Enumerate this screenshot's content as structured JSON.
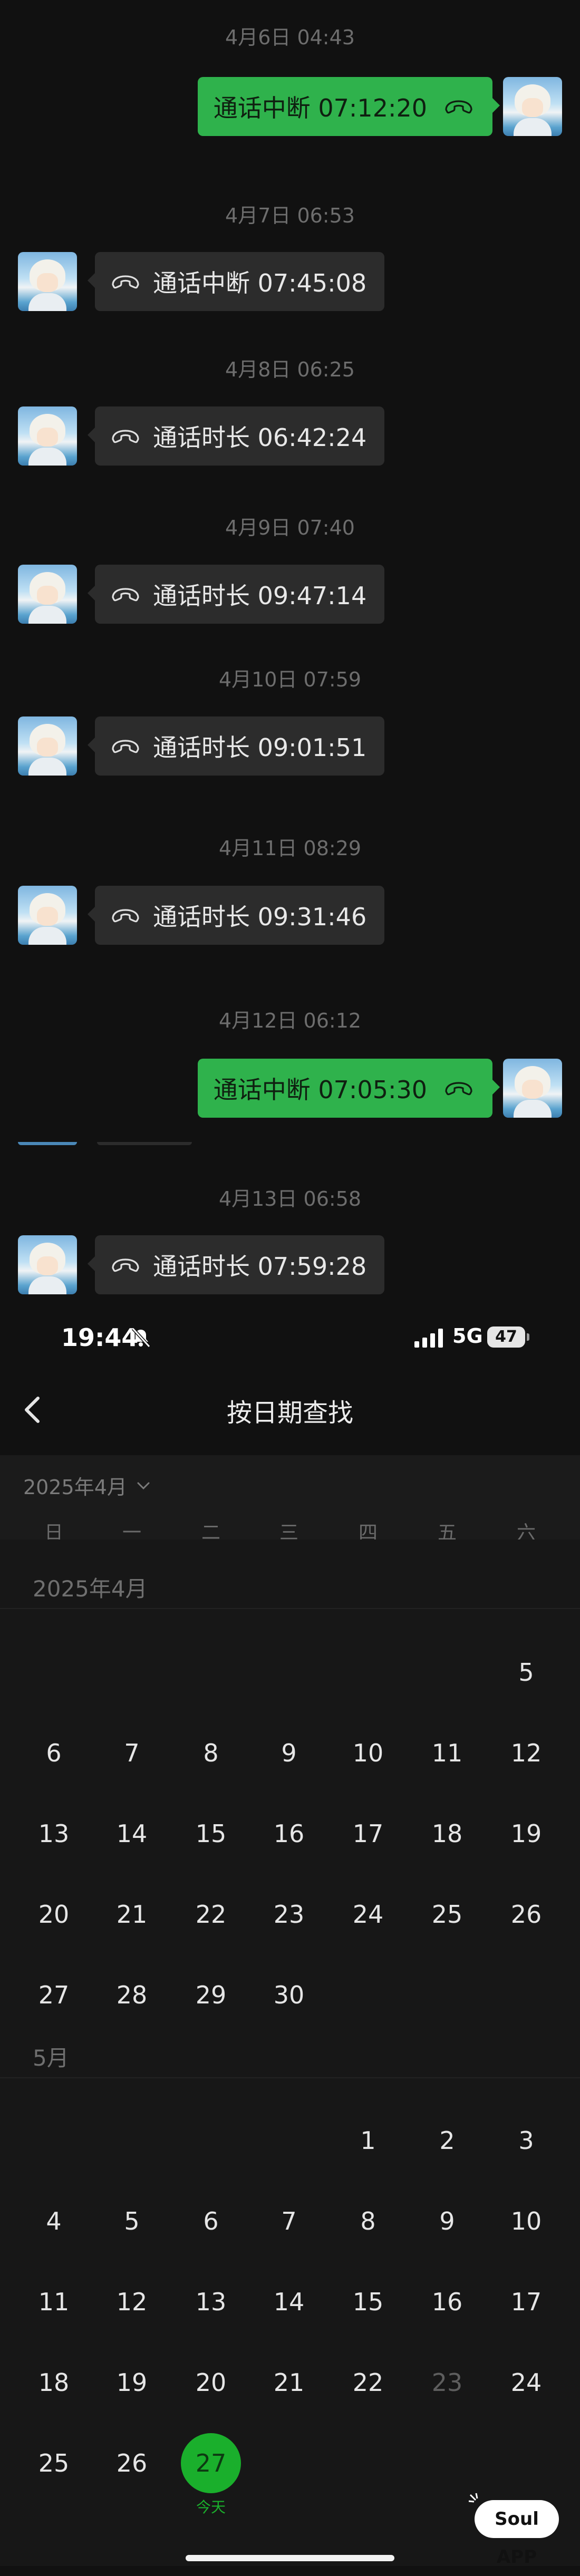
{
  "chat": {
    "messages": [
      {
        "timestamp": "4月6日 04:43",
        "direction": "out",
        "text": "通话中断 07:12:20"
      },
      {
        "timestamp": "4月7日 06:53",
        "direction": "in",
        "text": "通话中断 07:45:08"
      },
      {
        "timestamp": "4月8日 06:25",
        "direction": "in",
        "text": "通话时长 06:42:24"
      },
      {
        "timestamp": "4月9日 07:40",
        "direction": "in",
        "text": "通话时长 09:47:14"
      },
      {
        "timestamp": "4月10日 07:59",
        "direction": "in",
        "text": "通话时长 09:01:51"
      },
      {
        "timestamp": "4月11日 08:29",
        "direction": "in",
        "text": "通话时长 09:31:46"
      },
      {
        "timestamp": "4月12日 06:12",
        "direction": "out",
        "text": "通话中断 07:05:30"
      },
      {
        "timestamp": "4月13日 06:58",
        "direction": "in",
        "text": "通话时长 07:59:28"
      }
    ],
    "call_icon": "phone-handset-icon",
    "colors": {
      "outgoing_bubble": "#2fb24c",
      "incoming_bubble": "#2c2c2c"
    }
  },
  "status_bar": {
    "time": "19:44",
    "silent_icon": "bell-slash-icon",
    "signal_icon": "signal-bars-icon",
    "network": "5G",
    "battery": "47"
  },
  "header": {
    "title": "按日期查找",
    "back_icon": "chevron-left-icon"
  },
  "month_selector": {
    "value": "2025年4月",
    "icon": "chevron-down-icon"
  },
  "weekdays": [
    "日",
    "一",
    "二",
    "三",
    "四",
    "五",
    "六"
  ],
  "calendar": {
    "months": [
      {
        "label": "2025年4月",
        "weeks": [
          [
            "",
            "",
            "",
            "",
            "",
            "",
            "5"
          ],
          [
            "6",
            "7",
            "8",
            "9",
            "10",
            "11",
            "12"
          ],
          [
            "13",
            "14",
            "15",
            "16",
            "17",
            "18",
            "19"
          ],
          [
            "20",
            "21",
            "22",
            "23",
            "24",
            "25",
            "26"
          ],
          [
            "27",
            "28",
            "29",
            "30",
            "",
            "",
            ""
          ]
        ]
      },
      {
        "label": "5月",
        "weeks": [
          [
            "",
            "",
            "",
            "",
            "1",
            "2",
            "3"
          ],
          [
            "4",
            "5",
            "6",
            "7",
            "8",
            "9",
            "10"
          ],
          [
            "11",
            "12",
            "13",
            "14",
            "15",
            "16",
            "17"
          ],
          [
            "18",
            "19",
            "20",
            "21",
            "22",
            "23",
            "24"
          ],
          [
            "25",
            "26",
            "27",
            "",
            "",
            "",
            ""
          ]
        ]
      }
    ],
    "dimmed_days": [
      "5月23"
    ],
    "today": {
      "month": "5月",
      "day": "27",
      "caption": "今天"
    },
    "colors": {
      "today": "#1aaf2c"
    }
  },
  "watermark": "Soul APP"
}
